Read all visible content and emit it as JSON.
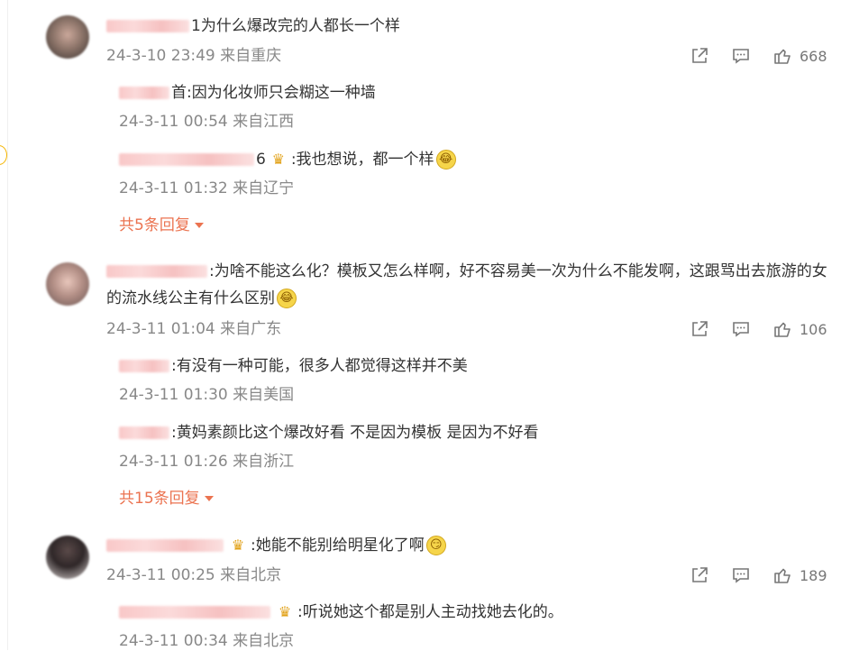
{
  "colors": {
    "meta": "#888888",
    "text": "#333333",
    "accent": "#eb7350",
    "badge": "#e2a21a"
  },
  "comments": [
    {
      "username": "1",
      "text": "为什么爆改完的人都长一个样",
      "time": "24-3-10 23:49",
      "location": "来自重庆",
      "likes": "668",
      "replies": [
        {
          "username": "首",
          "text": ":因为化妆师只会糊这一种墙",
          "time": "24-3-11 00:54",
          "location": "来自江西"
        },
        {
          "username": "6",
          "badge": "crown-badge-icon",
          "text": ":我也想说，都一个样",
          "emoji": "laugh-cry-emoji-icon",
          "time": "24-3-11 01:32",
          "location": "来自辽宁"
        }
      ],
      "more_label": "共5条回复"
    },
    {
      "username": "",
      "text": ":为啥不能这么化？模板又怎么样啊，好不容易美一次为什么不能发啊，这跟骂出去旅游的女的流水线公主有什么区别",
      "emoji": "laugh-cry-emoji-icon",
      "time": "24-3-11 01:04",
      "location": "来自广东",
      "likes": "106",
      "replies": [
        {
          "username": "",
          "text": ":有没有一种可能，很多人都觉得这样并不美",
          "time": "24-3-11 01:30",
          "location": "来自美国"
        },
        {
          "username": "",
          "text": ":黄妈素颜比这个爆改好看 不是因为模板 是因为不好看",
          "time": "24-3-11 01:26",
          "location": "来自浙江"
        }
      ],
      "more_label": "共15条回复"
    },
    {
      "username": "",
      "badge": "crown-badge-icon",
      "text": ":她能不能别给明星化了啊",
      "emoji": "smirk-emoji-icon",
      "time": "24-3-11 00:25",
      "location": "来自北京",
      "likes": "189",
      "replies": [
        {
          "username": "",
          "badge": "crown-badge-icon",
          "text": ":听说她这个都是别人主动找她去化的。",
          "time": "24-3-11 00:34",
          "location": "来自北京"
        }
      ]
    }
  ]
}
